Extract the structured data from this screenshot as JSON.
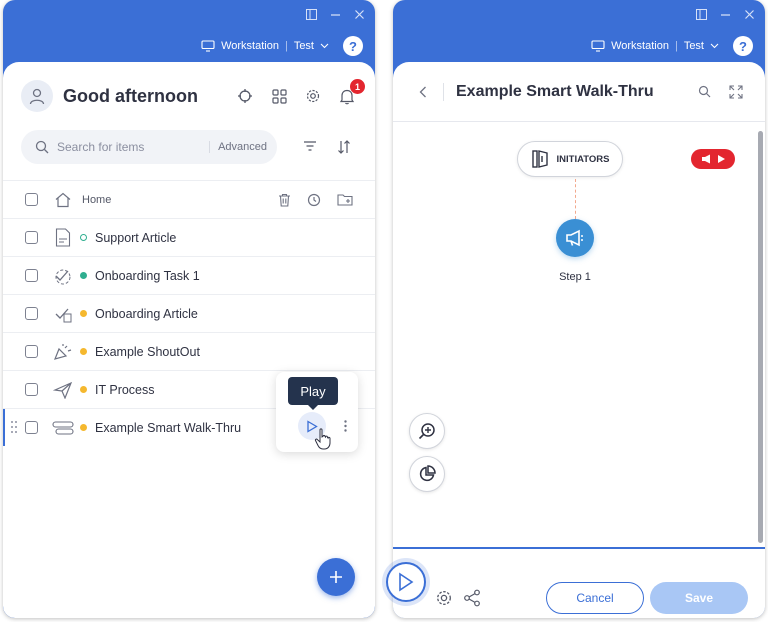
{
  "left": {
    "topbar": {
      "workstation": "Workstation",
      "separator": "|",
      "env": "Test",
      "help": "?"
    },
    "greeting": "Good afternoon",
    "notifications_count": "1",
    "search": {
      "placeholder": "Search for items",
      "advanced": "Advanced"
    },
    "home_label": "Home",
    "items": [
      {
        "label": "Support Article",
        "icon": "article-icon",
        "status": "draft",
        "dot_color": "#2fae8f"
      },
      {
        "label": "Onboarding Task 1",
        "icon": "onboarding-task-icon",
        "status": "published",
        "dot_color": "#2fae8f"
      },
      {
        "label": "Onboarding Article",
        "icon": "onboarding-article-icon",
        "status": "modified",
        "dot_color": "#f5b82e"
      },
      {
        "label": "Example ShoutOut",
        "icon": "shoutout-icon",
        "status": "modified",
        "dot_color": "#f5b82e"
      },
      {
        "label": "IT Process",
        "icon": "launcher-icon",
        "status": "modified",
        "dot_color": "#f5b82e"
      },
      {
        "label": "Example Smart Walk-Thru",
        "icon": "smart-walkthru-icon",
        "status": "modified",
        "dot_color": "#f5b82e"
      }
    ],
    "tooltip": "Play"
  },
  "right": {
    "topbar": {
      "workstation": "Workstation",
      "separator": "|",
      "env": "Test",
      "help": "?"
    },
    "title": "Example Smart Walk-Thru",
    "initiators_label": "INITIATORS",
    "step_label": "Step 1",
    "footer": {
      "cancel": "Cancel",
      "save": "Save"
    }
  },
  "colors": {
    "brand": "#3b6fd6",
    "published": "#2fae8f",
    "modified": "#f5b82e",
    "alert": "#e3262f"
  }
}
